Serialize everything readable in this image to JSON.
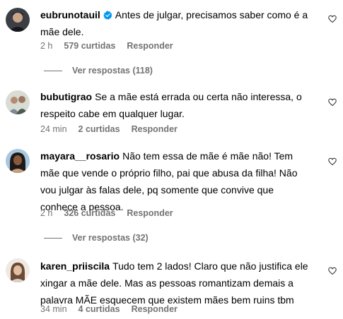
{
  "comments": [
    {
      "username": "eubrunotauil",
      "verified": true,
      "text": "Antes de julgar, precisamos saber como é a mãe dele.",
      "time": "2 h",
      "likes": "579 curtidas",
      "reply": "Responder",
      "view_replies": "Ver respostas (118)"
    },
    {
      "username": "bubutigrao",
      "verified": false,
      "text": "Se a mãe está errada ou certa não interessa, o respeito cabe em qualquer lugar.",
      "time": "24 min",
      "likes": "2 curtidas",
      "reply": "Responder"
    },
    {
      "username": "mayara__rosario",
      "verified": false,
      "text": "Não tem essa de mãe é mãe não! Tem mãe que vende o próprio filho, pai que abusa da filha! Não vou julgar às falas dele, pq somente que convive que conhece a pessoa.",
      "time": "2 h",
      "likes": "326 curtidas",
      "reply": "Responder",
      "view_replies": "Ver respostas (32)"
    },
    {
      "username": "karen_priiscila",
      "verified": false,
      "text": "Tudo tem 2 lados! Claro que não justifica ele xingar a mãe dele. Mas as pessoas romantizam demais a palavra MÃE esquecem que existem mães bem ruins tbm",
      "time": "34 min",
      "likes": "4 curtidas",
      "reply": "Responder"
    }
  ],
  "icons": {
    "like": "heart-outline-icon",
    "verified": "verified-badge-icon",
    "accent": "#0095f6"
  }
}
